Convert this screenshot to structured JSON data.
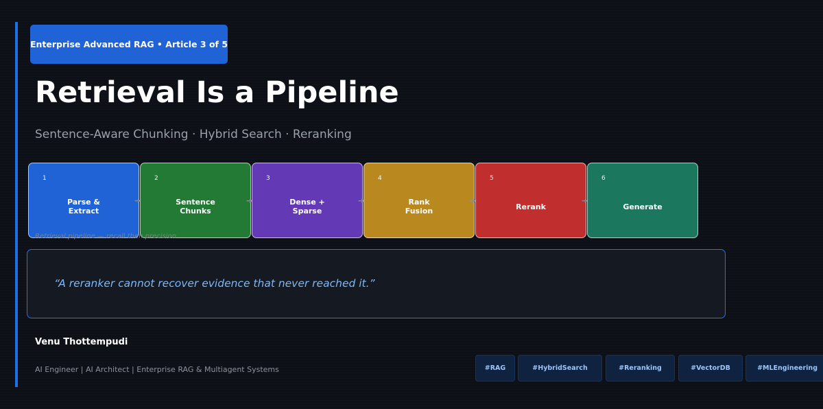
{
  "series_badge": "Enterprise Advanced RAG  •  Article 3 of 5",
  "title": "Retrieval Is a Pipeline",
  "subtitle": "Sentence-Aware Chunking  ·  Hybrid Search  ·  Reranking",
  "pipeline": {
    "stages": [
      {
        "number": "1",
        "label": "Parse &\nExtract",
        "color": "#1f63d6"
      },
      {
        "number": "2",
        "label": "Sentence\nChunks",
        "color": "#237a34"
      },
      {
        "number": "3",
        "label": "Dense +\nSparse",
        "color": "#6439b5"
      },
      {
        "number": "4",
        "label": "Rank\nFusion",
        "color": "#b98920"
      },
      {
        "number": "5",
        "label": "Rerank",
        "color": "#c12e2e"
      },
      {
        "number": "6",
        "label": "Generate",
        "color": "#1b775d"
      }
    ],
    "arrow_glyph": "➔",
    "caption": "Retrieval pipeline — recall then precision"
  },
  "quote": "“A reranker cannot recover evidence that never reached it.”",
  "author": {
    "name": "Venu Thottempudi",
    "role": "AI Engineer  |  AI Architect  |  Enterprise RAG & Multiagent Systems"
  },
  "tags": [
    "#RAG",
    "#HybridSearch",
    "#Reranking",
    "#VectorDB",
    "#MLEngineering"
  ]
}
